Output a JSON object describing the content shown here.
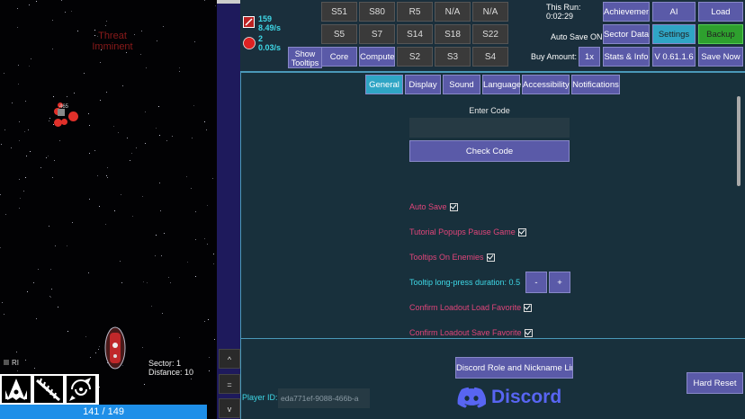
{
  "game": {
    "threat_text": "Threat\nImminent",
    "enemy_tag": "465",
    "sector_label": "Sector: 1",
    "distance_label": "Distance: 10",
    "ri_label": "RI",
    "hp_text": "141 / 149",
    "side_buttons": [
      "^",
      "=",
      "v"
    ]
  },
  "resources": {
    "res1_amount": "159",
    "res1_rate": "8.49/s",
    "res2_amount": "2",
    "res2_rate": "0.03/s",
    "show_tooltips": "Show Tooltips"
  },
  "grid_buttons": {
    "row1": [
      "S51",
      "S80",
      "R5",
      "N/A",
      "N/A"
    ],
    "row2": [
      "S5",
      "S7",
      "S14",
      "S18",
      "S22"
    ],
    "row3": [
      "Core",
      "Compute",
      "S2",
      "S3",
      "S4"
    ]
  },
  "run_info": {
    "this_run_label": "This Run:",
    "this_run_time": "0:02:29",
    "auto_save": "Auto Save ON",
    "buy_amount_label": "Buy Amount:",
    "buy_amount_value": "1x"
  },
  "right_buttons": {
    "row1": [
      "Achievemen",
      "AI",
      "Load"
    ],
    "row2": [
      "Sector Data",
      "Settings",
      "Backup"
    ],
    "row3": [
      "Stats & Info",
      "V 0.61.1.6",
      "Save Now"
    ]
  },
  "tabs": [
    "General",
    "Display",
    "Sound",
    "Language",
    "Accessibility",
    "Notifications"
  ],
  "code": {
    "title": "Enter Code",
    "input_value": "",
    "check_button": "Check Code"
  },
  "settings": [
    {
      "label": "Auto Save",
      "checked": true
    },
    {
      "label": "Tutorial Popups Pause Game",
      "checked": true
    },
    {
      "label": "Tooltips On Enemies",
      "checked": true
    },
    {
      "label": "Confirm Loadout Load Favorite",
      "checked": true
    },
    {
      "label": "Confirm Loadout Save Favorite",
      "checked": true
    }
  ],
  "tooltip_duration": {
    "label": "Tooltip long-press duration: 0.5",
    "minus": "-",
    "plus": "+"
  },
  "footer": {
    "discord_link_button": "Discord Role and Nickname Link",
    "player_id_label": "Player ID:",
    "player_id_value": "eda771ef-9088-466b-a",
    "discord_wordmark": "Discord",
    "hard_reset": "Hard Reset"
  },
  "colors": {
    "accent": "#2fa5c5",
    "button": "#5a5aa8",
    "backup": "#2ea02e",
    "setting_label": "#e0457a",
    "resource_text": "#3ed7e6",
    "hp_bar": "#1e8fe8"
  }
}
